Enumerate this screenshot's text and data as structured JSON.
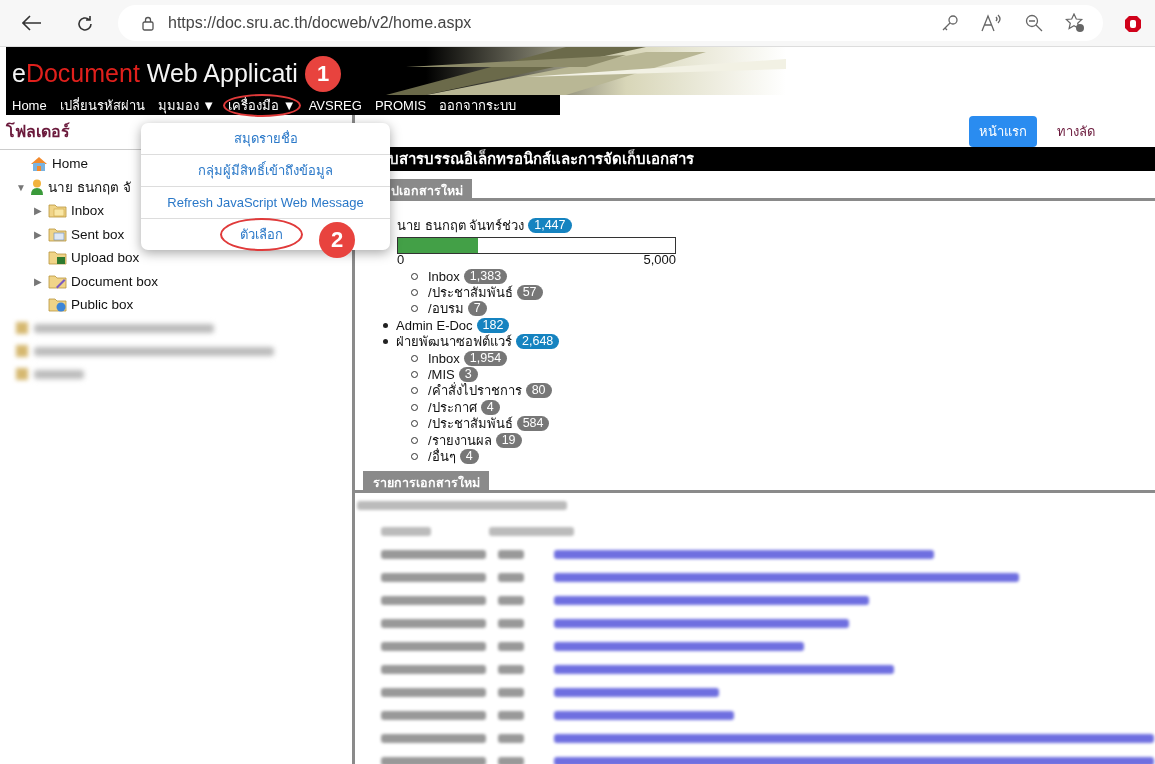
{
  "browser": {
    "url": "https://doc.sru.ac.th/docweb/v2/home.aspx"
  },
  "banner": {
    "title": [
      {
        "text": "e",
        "kind": "plain"
      },
      {
        "text": "Document",
        "kind": "accent"
      },
      {
        "text": " Web Applicati",
        "kind": "plain"
      }
    ]
  },
  "nav": [
    {
      "label": "Home",
      "circled": false
    },
    {
      "label": "เปลี่ยนรหัสผ่าน",
      "circled": false
    },
    {
      "label": "มุมมอง ▼",
      "circled": false
    },
    {
      "label": "เครื่องมือ ▼",
      "circled": true
    },
    {
      "label": "AVSREG",
      "circled": false
    },
    {
      "label": "PROMIS",
      "circled": false
    },
    {
      "label": "ออกจากระบบ",
      "circled": false
    }
  ],
  "sidebar": {
    "title": "โฟลเดอร์",
    "tree": [
      {
        "label": "Home",
        "kind": "home"
      },
      {
        "label": "นาย ธนกฤต จั",
        "kind": "user",
        "arrow": "▼",
        "children": [
          {
            "label": "Inbox",
            "kind": "inbox",
            "arrow": "▶"
          },
          {
            "label": "Sent box",
            "kind": "sent",
            "arrow": "▶"
          },
          {
            "label": "Upload box",
            "kind": "upload"
          },
          {
            "label": "Document box",
            "kind": "document",
            "arrow": "▶"
          },
          {
            "label": "Public box",
            "kind": "public"
          }
        ]
      }
    ]
  },
  "menu": [
    {
      "label": "สมุดรายชื่อ",
      "circled": false
    },
    {
      "label": "กลุ่มผู้มีสิทธิ์เข้าถึงข้อมูล",
      "circled": false
    },
    {
      "label": "Refresh JavaScript Web Message",
      "circled": false
    },
    {
      "label": "ตัวเลือก",
      "circled": true
    }
  ],
  "callouts": [
    {
      "number": "1"
    },
    {
      "number": "2"
    }
  ],
  "top_links": [
    {
      "label": "หน้าแรก",
      "selected": true
    },
    {
      "label": "ทางลัด",
      "selected": false
    }
  ],
  "main": {
    "title": "บสารบรรณอิเล็กทรอนิกส์และการจัดเก็บเอกสาร",
    "summary_tab": "ปเอกสารใหม่",
    "owner": {
      "name": "นาย ธนกฤต จันทร์ช่วง",
      "count": "1,447",
      "level": 0.29,
      "axis_min": "0",
      "axis_max": "5,000",
      "children": [
        {
          "name": "Inbox",
          "count": "1,383"
        },
        {
          "name": "/ประชาสัมพันธ์",
          "count": "57"
        },
        {
          "name": "/อบรม",
          "count": "7"
        }
      ]
    },
    "groups": [
      {
        "name": "Admin E-Doc",
        "count": "182"
      },
      {
        "name": "ฝ่ายพัฒนาซอฟต์แวร์",
        "count": "2,648",
        "children": [
          {
            "name": "Inbox",
            "count": "1,954"
          },
          {
            "name": "/MIS",
            "count": "3"
          },
          {
            "name": "/คำสั่งไปราชการ",
            "count": "80"
          },
          {
            "name": "/ประกาศ",
            "count": "4"
          },
          {
            "name": "/ประชาสัมพันธ์",
            "count": "584"
          },
          {
            "name": "/รายงานผล",
            "count": "19"
          },
          {
            "name": "/อื่นๆ",
            "count": "4"
          }
        ]
      }
    ],
    "list_tab": "รายการเอกสารใหม่"
  }
}
